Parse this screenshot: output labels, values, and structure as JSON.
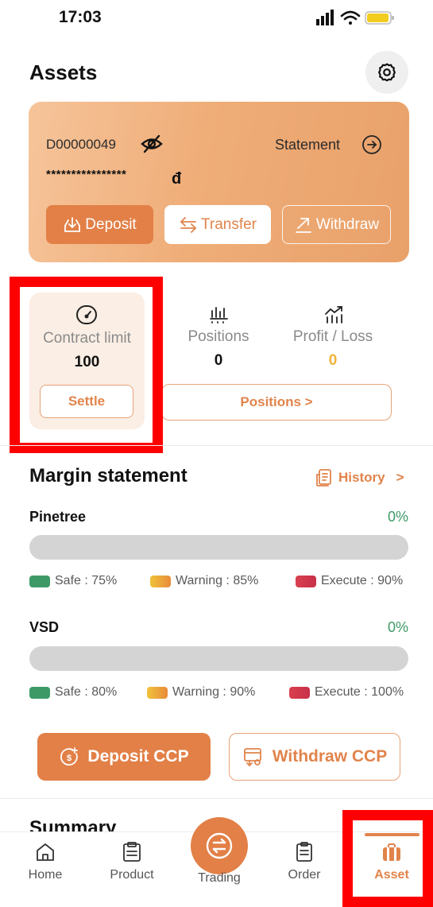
{
  "status_bar": {
    "time": "17:03"
  },
  "header": {
    "title": "Assets"
  },
  "account": {
    "id": "D00000049",
    "statement_label": "Statement",
    "masked_balance": "****************",
    "currency_symbol": "đ",
    "buttons": {
      "deposit": "Deposit",
      "transfer": "Transfer",
      "withdraw": "Withdraw"
    }
  },
  "stats": {
    "contract_limit": {
      "label": "Contract limit",
      "value": "100",
      "button": "Settle"
    },
    "positions": {
      "label": "Positions",
      "value": "0"
    },
    "profit_loss": {
      "label": "Profit / Loss",
      "value": "0"
    },
    "positions_button": "Positions >"
  },
  "margin": {
    "title": "Margin statement",
    "history_label": "History",
    "history_chevron": ">",
    "groups": [
      {
        "name": "Pinetree",
        "percent": "0%",
        "fill": 0,
        "safe": "Safe : 75%",
        "warning": "Warning : 85%",
        "execute": "Execute : 90%"
      },
      {
        "name": "VSD",
        "percent": "0%",
        "fill": 0,
        "safe": "Safe : 80%",
        "warning": "Warning : 90%",
        "execute": "Execute : 100%"
      }
    ]
  },
  "ccp": {
    "deposit": "Deposit CCP",
    "withdraw": "Withdraw CCP"
  },
  "summary_title": "Summary",
  "nav": {
    "home": "Home",
    "product": "Product",
    "trading": "Trading",
    "order": "Order",
    "asset": "Asset",
    "active": "asset"
  },
  "colors": {
    "accent": "#e1844b",
    "safe": "#3d9a67",
    "warning": "#f0b43a",
    "execute": "#d9404e",
    "highlight": "#ff0000"
  }
}
